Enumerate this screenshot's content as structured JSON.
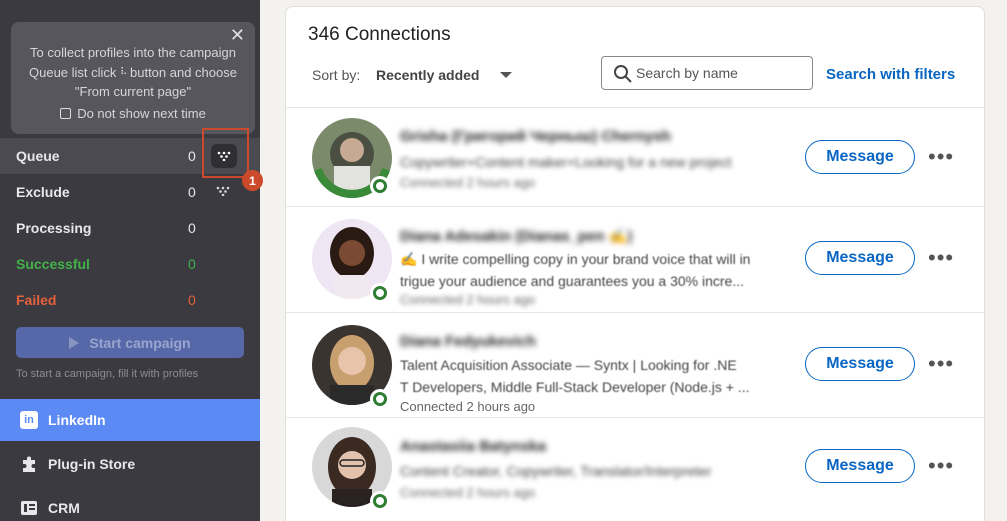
{
  "sidebar": {
    "tooltip": {
      "text_before": "To collect profiles into the campaign Queue list click",
      "text_after": "button and choose \"From current page\"",
      "checkbox_label": "Do not show next time"
    },
    "stats": [
      {
        "label": "Queue",
        "count": "0"
      },
      {
        "label": "Exclude",
        "count": "0"
      },
      {
        "label": "Processing",
        "count": "0"
      },
      {
        "label": "Successful",
        "count": "0"
      },
      {
        "label": "Failed",
        "count": "0"
      }
    ],
    "step_badge": "1",
    "start_button": "Start campaign",
    "hint": "To start a campaign, fill it with profiles",
    "nav": [
      {
        "label": "LinkedIn",
        "icon": "linkedin-icon",
        "active": true
      },
      {
        "label": "Plug-in Store",
        "icon": "puzzle-icon",
        "active": false
      },
      {
        "label": "CRM",
        "icon": "crm-icon",
        "active": false
      }
    ],
    "colors": {
      "successful": "#44b24a",
      "failed": "#e6603c",
      "active_nav": "#5b8af5"
    }
  },
  "main": {
    "title": "346 Connections",
    "sort_label": "Sort by:",
    "sort_value": "Recently added",
    "search_placeholder": "Search by name",
    "filters_link": "Search with filters",
    "connections": [
      {
        "name": "Grisha (Григорий Черныш) Chernysh",
        "headline1": "Copywriter+Content maker+Looking for a new project",
        "headline2": "",
        "time": "Connected 2 hours ago",
        "message": "Message"
      },
      {
        "name": "Diana Adesakin (Dianas_pen ✍)",
        "headline1": "✍ I write compelling copy in your brand voice that will in",
        "headline2": "trigue your audience and guarantees you a 30% incre...",
        "time": "Connected 2 hours ago",
        "message": "Message"
      },
      {
        "name": "Diana Fedyukevich",
        "headline1": "Talent Acquisition Associate — Syntx | Looking for .NE",
        "headline2": "T Developers, Middle Full-Stack Developer (Node.js + ...",
        "time": "Connected 2 hours ago",
        "message": "Message"
      },
      {
        "name": "Anastasiia Batynska",
        "headline1": "Content Creator, Copywriter, Translator/Interpreter",
        "headline2": "",
        "time": "Connected 2 hours ago",
        "message": "Message"
      }
    ]
  }
}
